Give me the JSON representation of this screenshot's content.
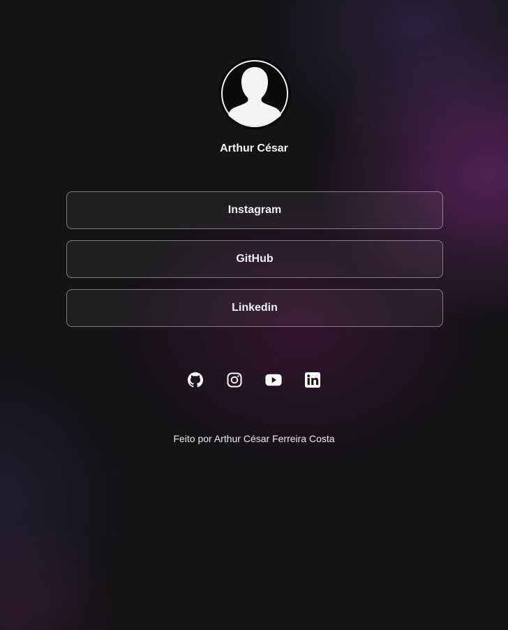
{
  "profile": {
    "name": "Arthur César",
    "avatar_icon": "user-silhouette-icon"
  },
  "links": [
    {
      "label": "Instagram"
    },
    {
      "label": "GitHub"
    },
    {
      "label": "Linkedin"
    }
  ],
  "socials": [
    {
      "icon": "github-icon"
    },
    {
      "icon": "instagram-icon"
    },
    {
      "icon": "youtube-icon"
    },
    {
      "icon": "linkedin-icon"
    }
  ],
  "footer": {
    "text": "Feito por Arthur César Ferreira Costa"
  },
  "colors": {
    "background": "#141316",
    "accent_glow": "#842d87",
    "text": "#ffffff"
  }
}
